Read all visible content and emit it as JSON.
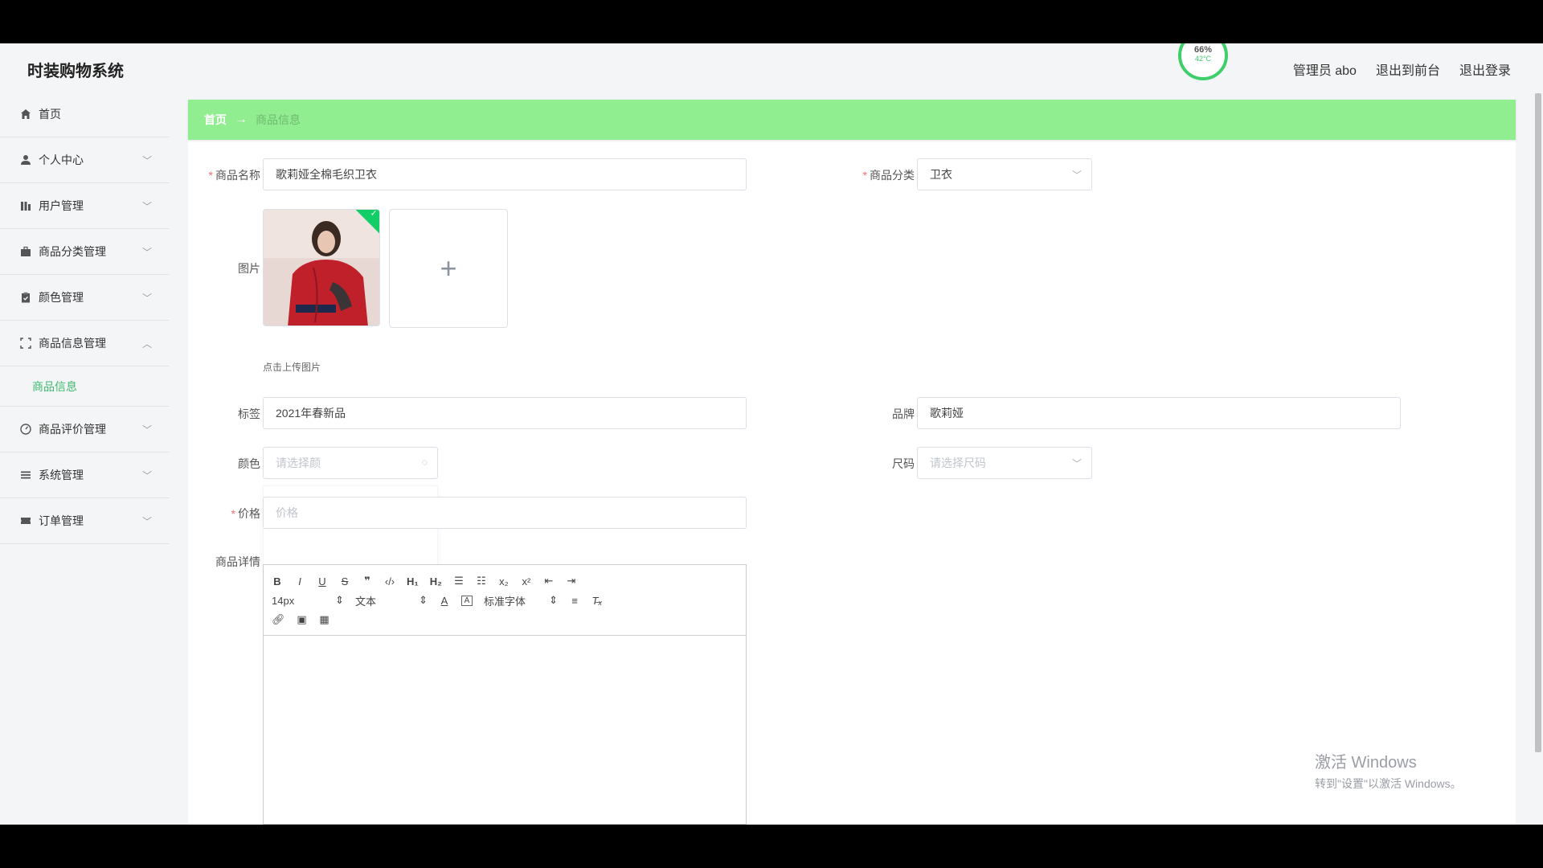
{
  "header": {
    "brand": "时装购物系统",
    "links": [
      "管理员 abo",
      "退出到前台",
      "退出登录"
    ],
    "temp_widget": {
      "pct": "66%",
      "deg": "42°C"
    }
  },
  "sidebar": {
    "items": [
      {
        "label": "首页",
        "icon": "home-icon"
      },
      {
        "label": "个人中心",
        "icon": "user-icon"
      },
      {
        "label": "用户管理",
        "icon": "chart-icon"
      },
      {
        "label": "商品分类管理",
        "icon": "briefcase-icon"
      },
      {
        "label": "颜色管理",
        "icon": "clipboard-icon"
      },
      {
        "label": "商品信息管理",
        "icon": "frame-icon"
      },
      {
        "label": "商品评价管理",
        "icon": "dashboard-icon"
      },
      {
        "label": "系统管理",
        "icon": "list-icon"
      },
      {
        "label": "订单管理",
        "icon": "ticket-icon"
      }
    ],
    "sub_item": "商品信息"
  },
  "breadcrumb": {
    "home": "首页",
    "current": "商品信息"
  },
  "form": {
    "name_label": "商品名称",
    "name_value": "歌莉娅全棉毛织卫衣",
    "category_label": "商品分类",
    "category_value": "卫衣",
    "image_label": "图片",
    "upload_tip": "点击上传图片",
    "tag_label": "标签",
    "tag_value": "2021年春新品",
    "brand_label": "品牌",
    "brand_value": "歌莉娅",
    "color_label": "颜色",
    "color_placeholder": "请选择颜",
    "size_label": "尺码",
    "size_placeholder": "请选择尺码",
    "price_label": "价格",
    "price_placeholder": "价格",
    "detail_label": "商品详情",
    "editor": {
      "font_size": "14px",
      "text_type": "文本",
      "font_family": "标准字体"
    }
  },
  "watermark": {
    "line1": "激活 Windows",
    "line2": "转到\"设置\"以激活 Windows。"
  }
}
